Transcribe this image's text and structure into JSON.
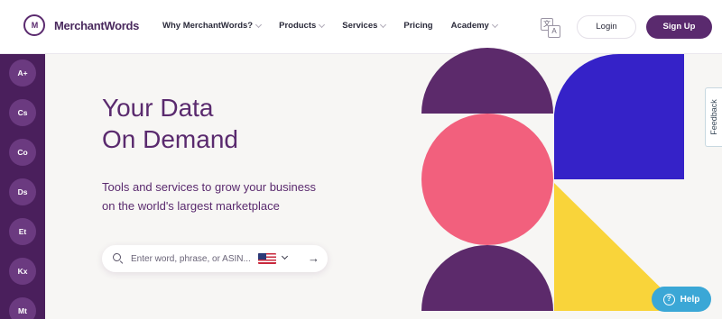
{
  "brand": {
    "name": "MerchantWords",
    "mark": "M"
  },
  "nav": [
    {
      "label": "Why MerchantWords?",
      "has_dropdown": true
    },
    {
      "label": "Products",
      "has_dropdown": true
    },
    {
      "label": "Services",
      "has_dropdown": true
    },
    {
      "label": "Pricing",
      "has_dropdown": false
    },
    {
      "label": "Academy",
      "has_dropdown": true
    }
  ],
  "language": {
    "icon": "translate-icon",
    "glyph_a": "文",
    "glyph_b": "A"
  },
  "auth": {
    "login_label": "Login",
    "signup_label": "Sign Up"
  },
  "sidebar": {
    "items": [
      {
        "label": "A+"
      },
      {
        "label": "Cs"
      },
      {
        "label": "Co"
      },
      {
        "label": "Ds"
      },
      {
        "label": "Et"
      },
      {
        "label": "Kx"
      },
      {
        "label": "Mt"
      }
    ]
  },
  "hero": {
    "title_line1": "Your Data",
    "title_line2": "On Demand",
    "subtitle_line1": "Tools and services to grow your business",
    "subtitle_line2": "on the world's largest marketplace"
  },
  "search": {
    "placeholder": "Enter word, phrase, or ASIN...",
    "value": "",
    "marketplace_flag": "us-flag-icon",
    "submit_icon": "arrow-right-icon",
    "submit_glyph": "→"
  },
  "feedback": {
    "label": "Feedback"
  },
  "help": {
    "label": "Help",
    "glyph": "?"
  },
  "colors": {
    "brand_purple": "#5a2a6e",
    "sidebar_purple": "#4a1f5c",
    "art_purple": "#5c2a6b",
    "art_pink": "#f2607d",
    "art_blue": "#3522c8",
    "art_yellow": "#f9d43a",
    "help_blue": "#3ba7d6"
  }
}
